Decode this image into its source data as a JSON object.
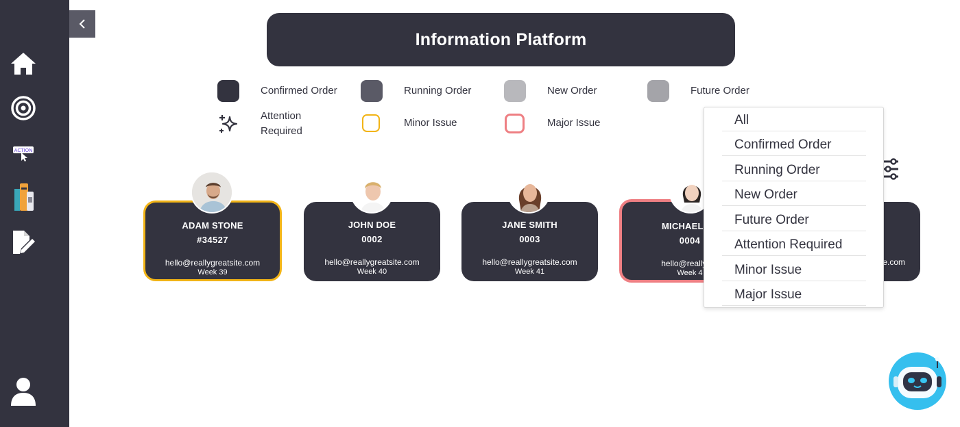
{
  "header": {
    "title": "Information Platform"
  },
  "sidebar": {
    "items": [
      {
        "icon": "home-icon"
      },
      {
        "icon": "target-icon"
      },
      {
        "icon": "action-icon",
        "label": "ACTION"
      },
      {
        "icon": "books-icon"
      },
      {
        "icon": "edit-document-icon"
      },
      {
        "icon": "user-icon"
      }
    ]
  },
  "legend": {
    "confirmed": "Confirmed Order",
    "running": "Running Order",
    "new": "New Order",
    "future": "Future Order",
    "attention_line1": "Attention",
    "attention_line2": "Required",
    "minor": "Minor Issue",
    "major": "Major Issue"
  },
  "colors": {
    "confirmed": "#33333f",
    "running": "#5a5a66",
    "new": "#b8b8bc",
    "future": "#a4a4a9",
    "minor_border": "#f2b416",
    "major_border": "#ee7f83"
  },
  "cards": [
    {
      "name": "ADAM STONE",
      "id": "#34527",
      "email": "hello@reallygreatsite.com",
      "week": "Week 39",
      "status": "minor"
    },
    {
      "name": "JOHN DOE",
      "id": "0002",
      "email": "hello@reallygreatsite.com",
      "week": "Week 40",
      "status": ""
    },
    {
      "name": "JANE SMITH",
      "id": "0003",
      "email": "hello@reallygreatsite.com",
      "week": "Week 41",
      "status": ""
    },
    {
      "name": "MICHAEL JO",
      "id": "0004",
      "email": "hello@reallygre",
      "week": "Week 4",
      "status": "major"
    },
    {
      "email": "e.com"
    }
  ],
  "dropdown": {
    "items": [
      "All",
      "Confirmed Order",
      "Running Order",
      "New Order",
      "Future Order",
      "Attention Required",
      "Minor Issue",
      "Major Issue"
    ]
  }
}
